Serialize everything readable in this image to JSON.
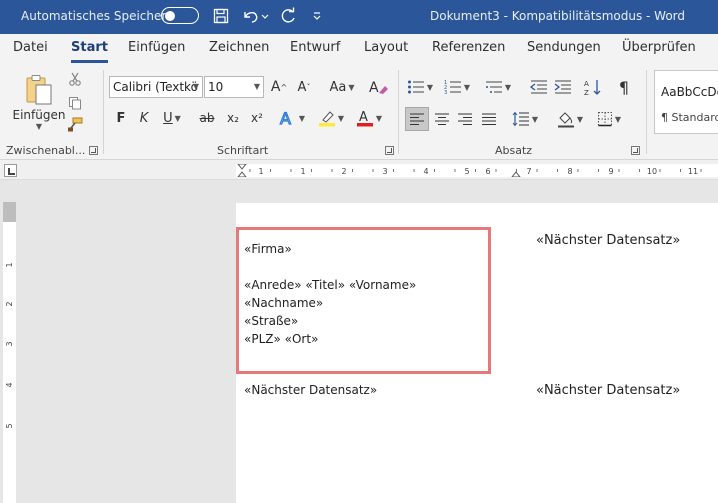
{
  "titlebar": {
    "autosave_label": "Automatisches Speichern",
    "document_title": "Dokument3  -  Kompatibilitätsmodus  -  Word",
    "bg_color": "#2b579a"
  },
  "tabs": [
    {
      "label": "Datei"
    },
    {
      "label": "Start"
    },
    {
      "label": "Einfügen"
    },
    {
      "label": "Zeichnen"
    },
    {
      "label": "Entwurf"
    },
    {
      "label": "Layout"
    },
    {
      "label": "Referenzen"
    },
    {
      "label": "Sendungen"
    },
    {
      "label": "Überprüfen"
    }
  ],
  "ribbon": {
    "clipboard": {
      "paste_label": "Einfügen",
      "group_label": "Zwischenabl..."
    },
    "font": {
      "font_name": "Calibri (Textkö",
      "font_size": "10",
      "grow_label": "A^",
      "shrink_label": "Aˇ",
      "case_label": "Aa",
      "bold": "F",
      "italic": "K",
      "underline": "U",
      "strike": "ab",
      "subscript": "x₂",
      "superscript": "x²",
      "group_label": "Schriftart"
    },
    "paragraph": {
      "pilcrow": "¶",
      "group_label": "Absatz"
    },
    "styles": {
      "sample": "AaBbCcDc",
      "name": "¶ Standard"
    }
  },
  "ruler": {
    "labels": [
      "1",
      "1",
      "2",
      "3",
      "4",
      "5",
      "6",
      "7",
      "8",
      "9",
      "10",
      "11"
    ],
    "vlabels": [
      "1",
      "2",
      "3",
      "4",
      "5"
    ]
  },
  "document": {
    "firma": "«Firma»",
    "line_anrede": "«Anrede» «Titel» «Vorname»",
    "line_nachname": " «Nachname»",
    "line_strasse": "«Straße»",
    "line_plz": "«PLZ» «Ort»",
    "next_record_1": "«Nächster Datensatz»",
    "next_record_2": "«Nächster Datensatz»",
    "next_record_3": "«Nächster Datensatz»"
  },
  "colors": {
    "selection_border": "#e8777a",
    "accent": "#2b579a"
  }
}
